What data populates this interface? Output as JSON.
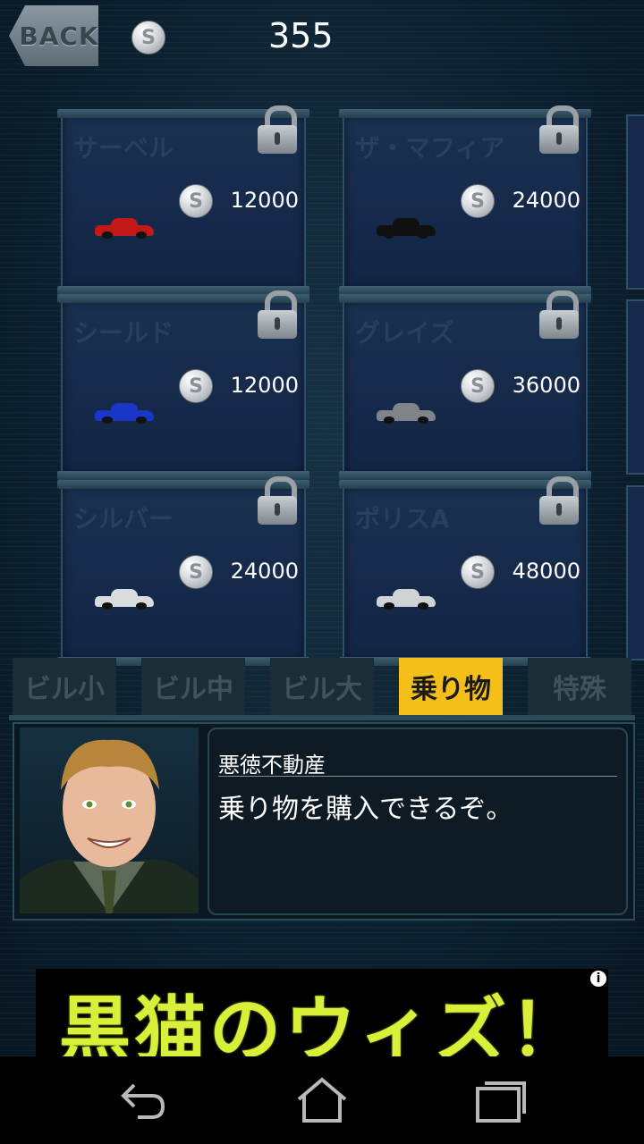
{
  "header": {
    "back_label": "BACK",
    "coin_count": "355"
  },
  "cards": [
    {
      "name": "サーベル",
      "price": "12000",
      "car_color": "#c41818",
      "locked": true
    },
    {
      "name": "ザ・マフィア",
      "price": "24000",
      "car_color": "#101010",
      "locked": true
    },
    {
      "name": "シールド",
      "price": "12000",
      "car_color": "#1a36c8",
      "locked": true
    },
    {
      "name": "グレイズ",
      "price": "36000",
      "car_color": "#808488",
      "locked": true
    },
    {
      "name": "シルバー",
      "price": "24000",
      "car_color": "#d8dcdf",
      "locked": true
    },
    {
      "name": "ポリスA",
      "price": "48000",
      "car_color": "#cfd3d6",
      "locked": true
    }
  ],
  "tabs": [
    {
      "label": "ビル小",
      "active": false
    },
    {
      "label": "ビル中",
      "active": false
    },
    {
      "label": "ビル大",
      "active": false
    },
    {
      "label": "乗り物",
      "active": true
    },
    {
      "label": "特殊",
      "active": false
    }
  ],
  "dialog": {
    "speaker": "悪徳不動産",
    "message": "乗り物を購入できるぞ。"
  },
  "ad": {
    "text": "黒猫のウィズ！",
    "info_icon": "i"
  },
  "colors": {
    "accent": "#f5bf1a",
    "ad_text": "#d8f03a"
  },
  "icons": {
    "coin": "S"
  }
}
